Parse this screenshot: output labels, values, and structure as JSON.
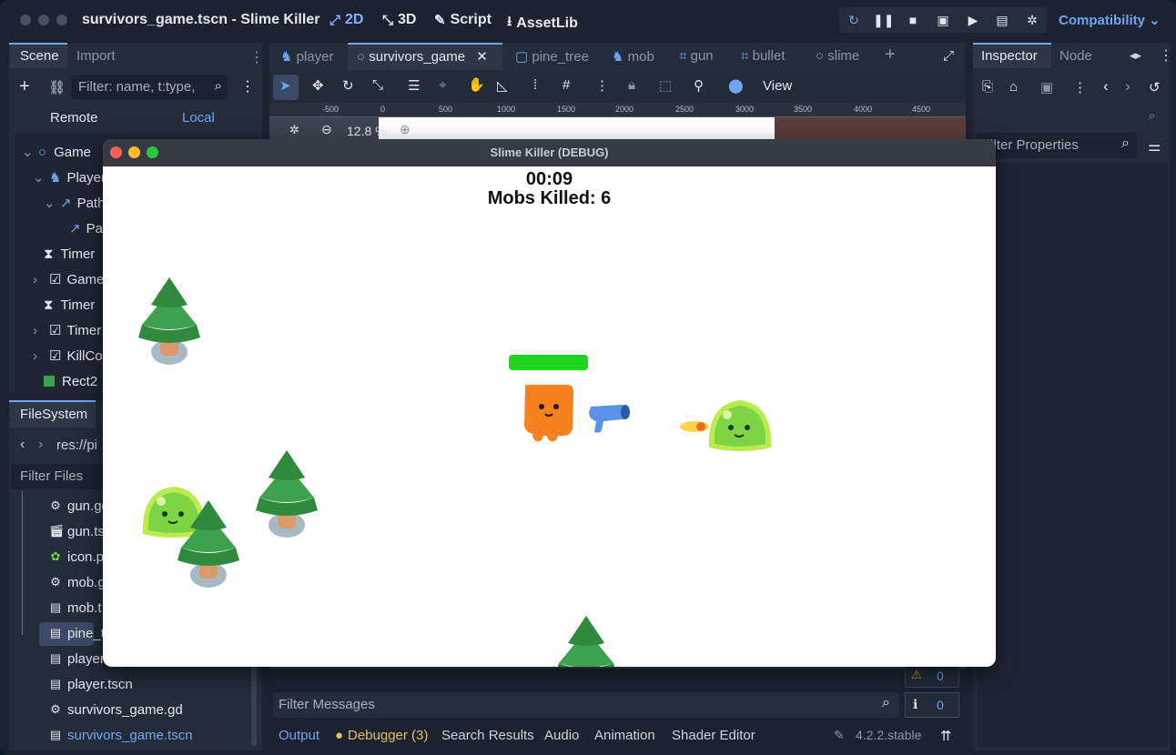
{
  "editor": {
    "title": "survivors_game.tscn - Slime Killer",
    "modes": [
      "2D",
      "3D",
      "Script",
      "AssetLib"
    ],
    "renderer": "Compatibility"
  },
  "scene_dock": {
    "tabs": [
      "Scene",
      "Import"
    ],
    "filter_placeholder": "Filter: name, t:type,",
    "remote": "Remote",
    "local": "Local",
    "tree": [
      "Game",
      "Player",
      "Path",
      "Pa",
      "Timer",
      "Game",
      "Timer",
      "Timer",
      "KillCou",
      "Rect2"
    ]
  },
  "filesystem": {
    "title": "FileSystem",
    "path": "res://pi",
    "filter_placeholder": "Filter Files",
    "files": [
      "gun.gd",
      "gun.ts",
      "icon.p",
      "mob.g",
      "mob.t",
      "pine_t",
      "player.",
      "player.tscn",
      "survivors_game.gd",
      "survivors_game.tscn"
    ]
  },
  "scene_tabs": [
    "player",
    "survivors_game",
    "pine_tree",
    "mob",
    "gun",
    "bullet",
    "slime"
  ],
  "viewport": {
    "view_label": "View",
    "zoom": "12.8 %",
    "ruler_ticks": [
      "-500",
      "0",
      "500",
      "1000",
      "1500",
      "2000",
      "2500",
      "3000",
      "3500",
      "4000",
      "4500"
    ]
  },
  "inspector": {
    "tabs": [
      "Inspector",
      "Node"
    ],
    "filter_placeholder": "Filter Properties"
  },
  "bottom_panel": {
    "filter_placeholder": "Filter Messages",
    "warnings": "0",
    "errors": "0",
    "tabs": [
      "Output",
      "Debugger (3)",
      "Search Results",
      "Audio",
      "Animation",
      "Shader Editor"
    ],
    "version": "4.2.2.stable"
  },
  "game_window": {
    "title": "Slime Killer (DEBUG)",
    "timer": "00:09",
    "kills": "Mobs Killed: 6"
  },
  "colors": {
    "accent": "#6fa6ef",
    "tree_dark": "#2f8a3e",
    "tree_light": "#3ea14e",
    "trunk": "#d99a6c",
    "player": "#f5821f",
    "slime": "#7ed444",
    "health": "#1ed41e",
    "gun": "#5a93e6"
  }
}
